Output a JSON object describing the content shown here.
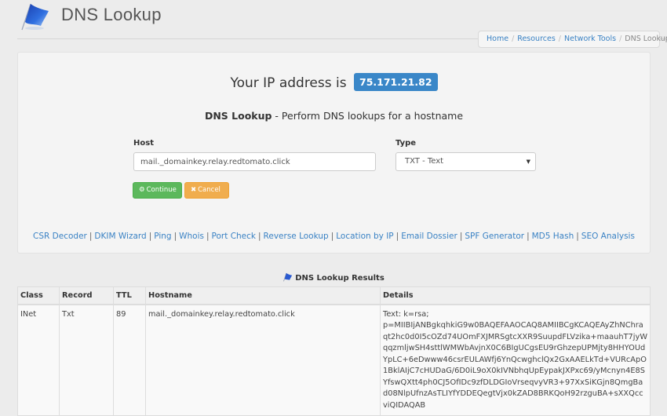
{
  "header": {
    "title": "DNS Lookup",
    "logo_icon": "flag-logo-icon"
  },
  "breadcrumb": [
    {
      "label": "Home",
      "link": true
    },
    {
      "label": "Resources",
      "link": true
    },
    {
      "label": "Network Tools",
      "link": true
    },
    {
      "label": "DNS Lookup",
      "link": false
    }
  ],
  "ip": {
    "prefix": "Your IP address is",
    "address": "75.171.21.82"
  },
  "form": {
    "title_bold": "DNS Lookup",
    "title_rest": " - Perform DNS lookups for a hostname",
    "host_label": "Host",
    "host_value": "mail._domainkey.relay.redtomato.click",
    "type_label": "Type",
    "type_value": "TXT - Text",
    "continue_label": "Continue",
    "continue_icon": "gear-icon",
    "cancel_label": "Cancel",
    "cancel_icon": "close-icon",
    "continue_color": "#5cb85c",
    "cancel_color": "#f0ad4e"
  },
  "tool_links": [
    "CSR Decoder",
    "DKIM Wizard",
    "Ping",
    "Whois",
    "Port Check",
    "Reverse Lookup",
    "Location by IP",
    "Email Dossier",
    "SPF Generator",
    "MD5 Hash",
    "SEO Analysis"
  ],
  "results": {
    "title": "DNS Lookup Results",
    "columns": [
      "Class",
      "Record",
      "TTL",
      "Hostname",
      "Details"
    ],
    "rows": [
      {
        "class": "INet",
        "record": "Txt",
        "ttl": "89",
        "hostname": "mail._domainkey.relay.redtomato.click",
        "details_line1": "Text: k=rsa;",
        "details_key": "p=MIIBIjANBgkqhkiG9w0BAQEFAAOCAQ8AMIIBCgKCAQEAyZhNChraqt2hc0d0I5cOZd74UOmFXJMRSgtcXXR9SuupdFLVzika+maauhT7jyWqqzmljwSH4sttlWMWbAvjnX0C6BIgUCgsEU9rGhzepUPMjty8HHYOUdYpLC+6eDwww46csrEULAWfj6YnQcwghclQx2GxAAELkTd+VURcApO1BklAIjC7cHUDaG/6D0iL9oX0kIVNbhqUpEypakJXPxc69/yMcnyn4E8SYfswQXtt4ph0CJ5OfIDc9zfDLDGIoVrseqvyVR3+97XxSiKGjn8QmgBad08NlpUfnzAsTLIYfYDDEQegtVjx0kZAD8BRKQoH92rzguBA+sXXQccviQIDAQAB"
      }
    ]
  },
  "colors": {
    "accent": "#3a87c8",
    "link": "#3a82c4",
    "background": "#ececec"
  }
}
